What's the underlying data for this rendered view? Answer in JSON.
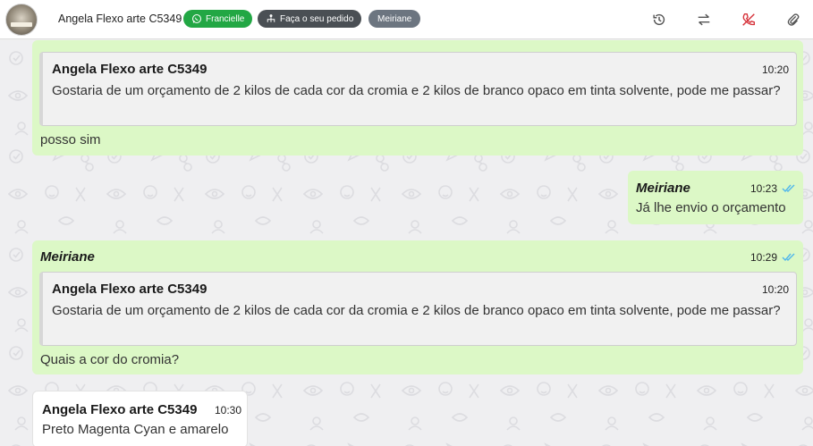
{
  "header": {
    "contact_name": "Angela Flexo arte C5349",
    "tags": [
      {
        "label": "Francielle",
        "color": "#22a744",
        "icon": "whatsapp-icon"
      },
      {
        "label": "Faça o seu pedido",
        "color": "#4a4f54",
        "icon": "workflow-icon"
      },
      {
        "label": "Meiriane",
        "color": "#6c7580"
      }
    ],
    "actions": [
      "history-icon",
      "transfer-icon",
      "end-call-icon",
      "attachment-icon"
    ],
    "end_call_color": "#d6333b"
  },
  "messages": [
    {
      "direction": "out",
      "quote": {
        "author": "Angela Flexo arte C5349",
        "time": "10:20",
        "text": "Gostaria de um orçamento de 2 kilos de cada cor da cromia e 2 kilos de branco opaco em tinta solvente, pode me passar?"
      },
      "text": "posso sim"
    },
    {
      "direction": "out",
      "sender": "Meiriane",
      "time": "10:23",
      "text": "Já lhe envio o orçamento",
      "status": "read"
    },
    {
      "direction": "out",
      "sender": "Meiriane",
      "time": "10:29",
      "status": "read",
      "quote": {
        "author": "Angela Flexo arte C5349",
        "time": "10:20",
        "text": "Gostaria de um orçamento de 2 kilos de cada cor da cromia e 2 kilos de branco opaco em tinta solvente, pode me passar?"
      },
      "text": "Quais a cor do cromia?"
    },
    {
      "direction": "in",
      "sender": "Angela Flexo arte C5349",
      "time": "10:30",
      "text": "Preto Magenta Cyan e amarelo"
    }
  ],
  "colors": {
    "outgoing_bubble": "#dcf8c6",
    "incoming_bubble": "#ffffff",
    "read_ticks": "#4fb6ec"
  }
}
